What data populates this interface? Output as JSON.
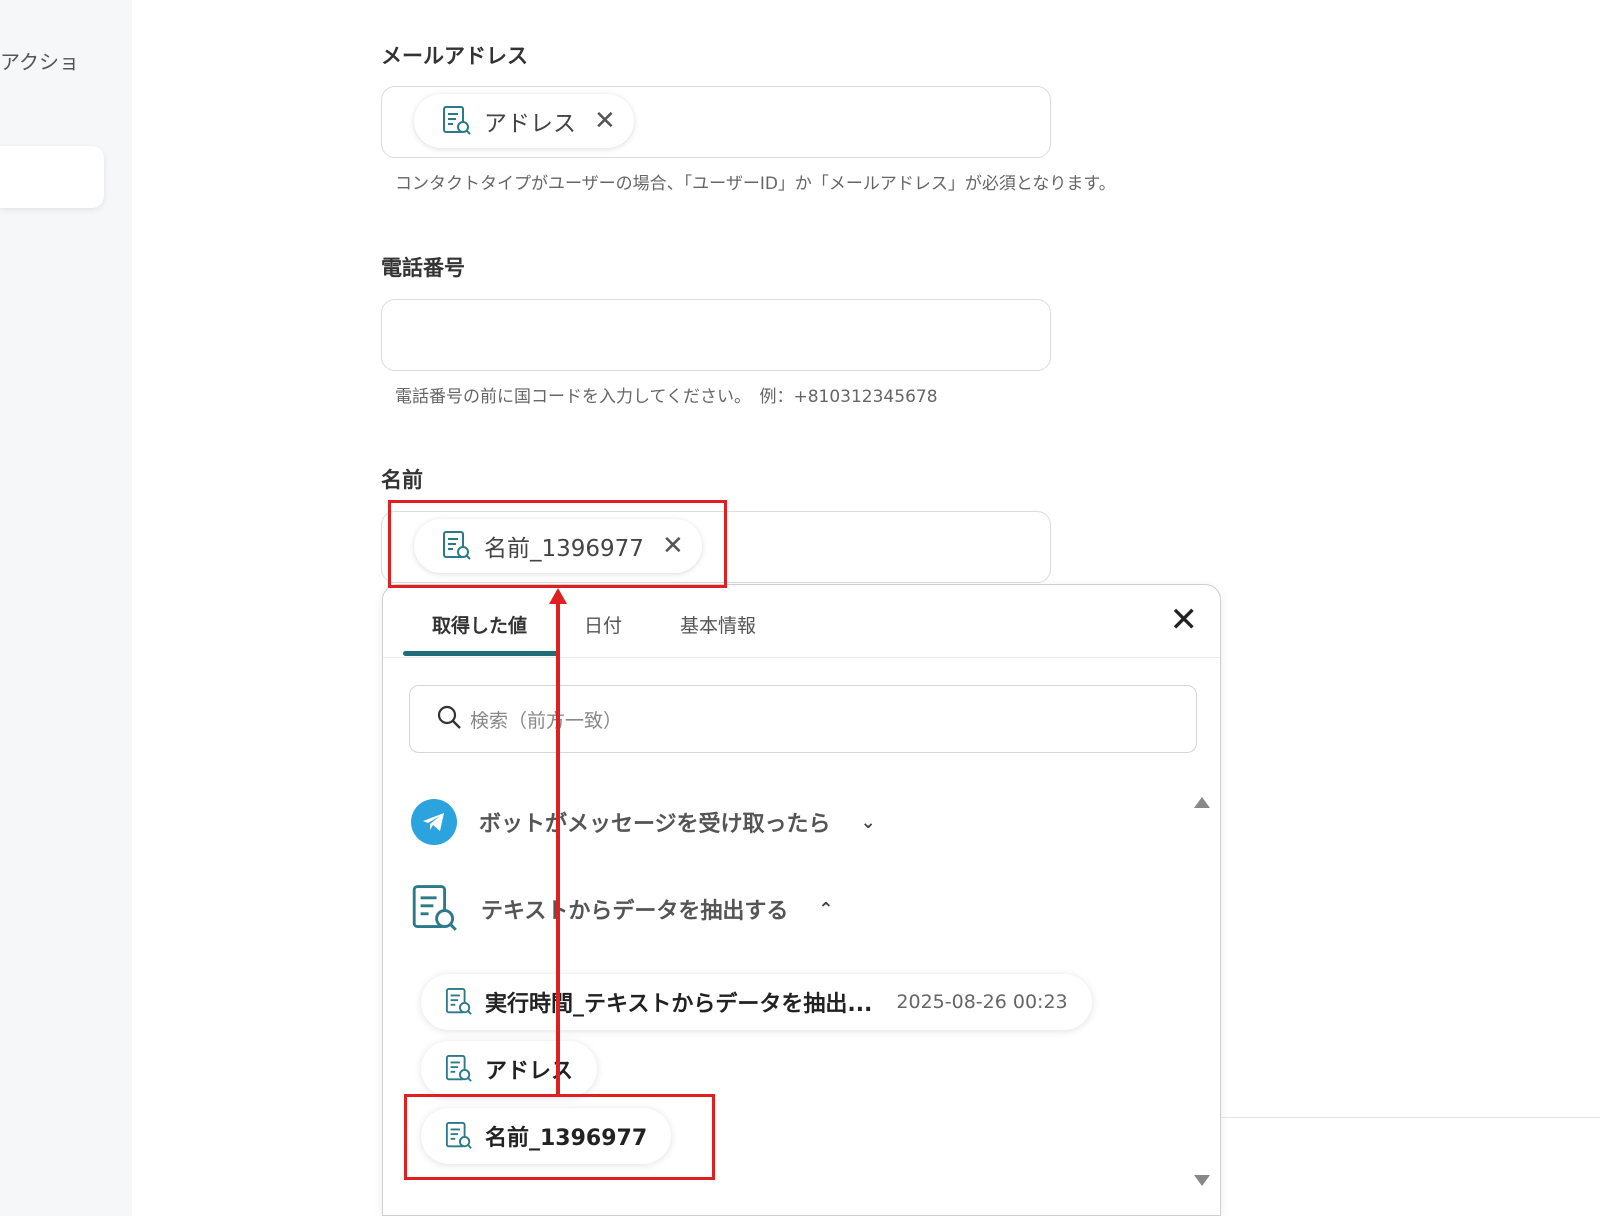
{
  "sidebar": {
    "label": "アクショ"
  },
  "fields": {
    "email": {
      "label": "メールアドレス",
      "chip": "アドレス",
      "help": "コンタクトタイプがユーザーの場合、「ユーザーID」か「メールアドレス」が必須となります。"
    },
    "phone": {
      "label": "電話番号",
      "value": "",
      "help": "電話番号の前に国コードを入力してください。　例：+810312345678"
    },
    "name": {
      "label": "名前",
      "chip": "名前_1396977"
    }
  },
  "popup": {
    "tabs": [
      "取得した値",
      "日付",
      "基本情報"
    ],
    "active_tab": 0,
    "search_placeholder": "検索（前方一致）",
    "groups": [
      {
        "label": "ボットがメッセージを受け取ったら",
        "icon": "telegram-icon",
        "expanded": false
      },
      {
        "label": "テキストからデータを抽出する",
        "icon": "document-search-icon",
        "expanded": true
      }
    ],
    "items": [
      {
        "label": "実行時間_テキストからデータを抽出...",
        "value": "2025-08-26 00:23"
      },
      {
        "label": "アドレス",
        "value": ""
      },
      {
        "label": "名前_1396977",
        "value": ""
      }
    ]
  },
  "colors": {
    "highlight": "#e02020",
    "accent": "#1f6e7a",
    "telegram": "#2aa3df"
  }
}
